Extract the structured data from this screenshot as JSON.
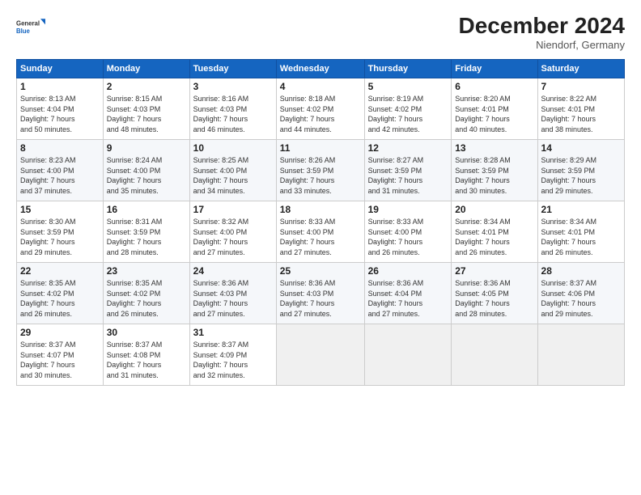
{
  "logo": {
    "line1": "General",
    "line2": "Blue"
  },
  "title": "December 2024",
  "location": "Niendorf, Germany",
  "days_of_week": [
    "Sunday",
    "Monday",
    "Tuesday",
    "Wednesday",
    "Thursday",
    "Friday",
    "Saturday"
  ],
  "weeks": [
    [
      {
        "day": "1",
        "info": "Sunrise: 8:13 AM\nSunset: 4:04 PM\nDaylight: 7 hours\nand 50 minutes."
      },
      {
        "day": "2",
        "info": "Sunrise: 8:15 AM\nSunset: 4:03 PM\nDaylight: 7 hours\nand 48 minutes."
      },
      {
        "day": "3",
        "info": "Sunrise: 8:16 AM\nSunset: 4:03 PM\nDaylight: 7 hours\nand 46 minutes."
      },
      {
        "day": "4",
        "info": "Sunrise: 8:18 AM\nSunset: 4:02 PM\nDaylight: 7 hours\nand 44 minutes."
      },
      {
        "day": "5",
        "info": "Sunrise: 8:19 AM\nSunset: 4:02 PM\nDaylight: 7 hours\nand 42 minutes."
      },
      {
        "day": "6",
        "info": "Sunrise: 8:20 AM\nSunset: 4:01 PM\nDaylight: 7 hours\nand 40 minutes."
      },
      {
        "day": "7",
        "info": "Sunrise: 8:22 AM\nSunset: 4:01 PM\nDaylight: 7 hours\nand 38 minutes."
      }
    ],
    [
      {
        "day": "8",
        "info": "Sunrise: 8:23 AM\nSunset: 4:00 PM\nDaylight: 7 hours\nand 37 minutes."
      },
      {
        "day": "9",
        "info": "Sunrise: 8:24 AM\nSunset: 4:00 PM\nDaylight: 7 hours\nand 35 minutes."
      },
      {
        "day": "10",
        "info": "Sunrise: 8:25 AM\nSunset: 4:00 PM\nDaylight: 7 hours\nand 34 minutes."
      },
      {
        "day": "11",
        "info": "Sunrise: 8:26 AM\nSunset: 3:59 PM\nDaylight: 7 hours\nand 33 minutes."
      },
      {
        "day": "12",
        "info": "Sunrise: 8:27 AM\nSunset: 3:59 PM\nDaylight: 7 hours\nand 31 minutes."
      },
      {
        "day": "13",
        "info": "Sunrise: 8:28 AM\nSunset: 3:59 PM\nDaylight: 7 hours\nand 30 minutes."
      },
      {
        "day": "14",
        "info": "Sunrise: 8:29 AM\nSunset: 3:59 PM\nDaylight: 7 hours\nand 29 minutes."
      }
    ],
    [
      {
        "day": "15",
        "info": "Sunrise: 8:30 AM\nSunset: 3:59 PM\nDaylight: 7 hours\nand 29 minutes."
      },
      {
        "day": "16",
        "info": "Sunrise: 8:31 AM\nSunset: 3:59 PM\nDaylight: 7 hours\nand 28 minutes."
      },
      {
        "day": "17",
        "info": "Sunrise: 8:32 AM\nSunset: 4:00 PM\nDaylight: 7 hours\nand 27 minutes."
      },
      {
        "day": "18",
        "info": "Sunrise: 8:33 AM\nSunset: 4:00 PM\nDaylight: 7 hours\nand 27 minutes."
      },
      {
        "day": "19",
        "info": "Sunrise: 8:33 AM\nSunset: 4:00 PM\nDaylight: 7 hours\nand 26 minutes."
      },
      {
        "day": "20",
        "info": "Sunrise: 8:34 AM\nSunset: 4:01 PM\nDaylight: 7 hours\nand 26 minutes."
      },
      {
        "day": "21",
        "info": "Sunrise: 8:34 AM\nSunset: 4:01 PM\nDaylight: 7 hours\nand 26 minutes."
      }
    ],
    [
      {
        "day": "22",
        "info": "Sunrise: 8:35 AM\nSunset: 4:02 PM\nDaylight: 7 hours\nand 26 minutes."
      },
      {
        "day": "23",
        "info": "Sunrise: 8:35 AM\nSunset: 4:02 PM\nDaylight: 7 hours\nand 26 minutes."
      },
      {
        "day": "24",
        "info": "Sunrise: 8:36 AM\nSunset: 4:03 PM\nDaylight: 7 hours\nand 27 minutes."
      },
      {
        "day": "25",
        "info": "Sunrise: 8:36 AM\nSunset: 4:03 PM\nDaylight: 7 hours\nand 27 minutes."
      },
      {
        "day": "26",
        "info": "Sunrise: 8:36 AM\nSunset: 4:04 PM\nDaylight: 7 hours\nand 27 minutes."
      },
      {
        "day": "27",
        "info": "Sunrise: 8:36 AM\nSunset: 4:05 PM\nDaylight: 7 hours\nand 28 minutes."
      },
      {
        "day": "28",
        "info": "Sunrise: 8:37 AM\nSunset: 4:06 PM\nDaylight: 7 hours\nand 29 minutes."
      }
    ],
    [
      {
        "day": "29",
        "info": "Sunrise: 8:37 AM\nSunset: 4:07 PM\nDaylight: 7 hours\nand 30 minutes."
      },
      {
        "day": "30",
        "info": "Sunrise: 8:37 AM\nSunset: 4:08 PM\nDaylight: 7 hours\nand 31 minutes."
      },
      {
        "day": "31",
        "info": "Sunrise: 8:37 AM\nSunset: 4:09 PM\nDaylight: 7 hours\nand 32 minutes."
      },
      {
        "day": "",
        "info": ""
      },
      {
        "day": "",
        "info": ""
      },
      {
        "day": "",
        "info": ""
      },
      {
        "day": "",
        "info": ""
      }
    ]
  ]
}
